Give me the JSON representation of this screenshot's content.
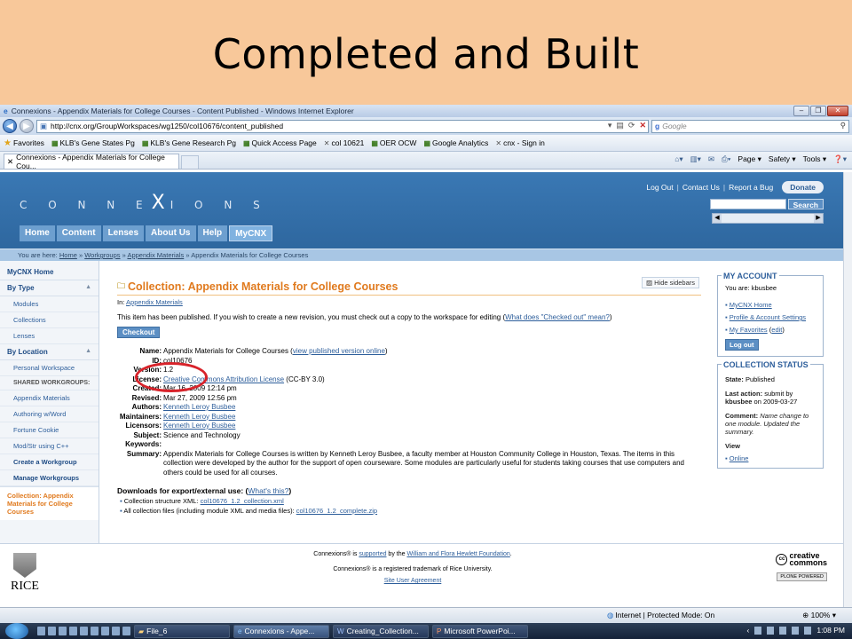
{
  "slide": {
    "title": "Completed and Built"
  },
  "browser": {
    "window_title": "Connexions - Appendix Materials for College Courses - Content Published - Windows Internet Explorer",
    "url": "http://cnx.org/GroupWorkspaces/wg1250/col10676/content_published",
    "search_placeholder": "Google",
    "favorites_label": "Favorites",
    "favorites": [
      "KLB's Gene States Pg",
      "KLB's Gene Research Pg",
      "Quick Access Page",
      "col 10621",
      "OER OCW",
      "Google Analytics",
      "cnx - Sign in"
    ],
    "tab_label": "Connexions - Appendix Materials for College Cou...",
    "commands": {
      "page": "Page",
      "safety": "Safety",
      "tools": "Tools"
    },
    "status_zone": "Internet | Protected Mode: On",
    "zoom": "100%"
  },
  "site": {
    "logo": {
      "left": "C O N N E",
      "mid": "X",
      "right": "I O N S"
    },
    "top_links": [
      "Log Out",
      "Contact Us",
      "Report a Bug"
    ],
    "donate": "Donate",
    "search_button": "Search",
    "nav_tabs": [
      "Home",
      "Content",
      "Lenses",
      "About Us",
      "Help",
      "MyCNX"
    ],
    "breadcrumb": {
      "prefix": "You are here:",
      "home": "Home",
      "workgroups": "Workgroups",
      "appendix": "Appendix Materials",
      "current": "Appendix Materials for College Courses"
    }
  },
  "sidebar": {
    "mycnx_home": "MyCNX Home",
    "by_type": "By Type",
    "type_items": [
      "Modules",
      "Collections",
      "Lenses"
    ],
    "by_location": "By Location",
    "personal_ws": "Personal Workspace",
    "shared_caption": "SHARED WORKGROUPS:",
    "workgroups": [
      "Appendix Materials",
      "Authoring w/Word",
      "Fortune Cookie",
      "Mod/Str using C++"
    ],
    "create_workgroup": "Create a Workgroup",
    "manage_workgroups": "Manage Workgroups",
    "current": "Collection: Appendix Materials for College Courses"
  },
  "main": {
    "title": "Collection: Appendix Materials for College Courses",
    "hide_sidebars": "Hide sidebars",
    "in_prefix": "In:",
    "in_link": "Appendix Materials",
    "published_msg": "This item has been published. If you wish to create a new revision, you must check out a copy to the workspace for editing (",
    "checked_out_link": "What does \"Checked out\" mean?",
    "published_msg_end": ")",
    "checkout": "Checkout",
    "meta": {
      "name_k": "Name:",
      "name_v": "Appendix Materials for College Courses (",
      "name_link": "view published version online",
      "name_end": ")",
      "id_k": "ID:",
      "id_v": "col10676",
      "version_k": "Version:",
      "version_v": "1.2",
      "license_k": "License:",
      "license_link": "Creative Commons Attribution License",
      "license_end": " (CC-BY 3.0)",
      "created_k": "Created:",
      "created_v": "Mar 16, 2009 12:14 pm",
      "revised_k": "Revised:",
      "revised_v": "Mar 27, 2009 12:56 pm",
      "authors_k": "Authors:",
      "authors_v": "Kenneth Leroy Busbee",
      "maintainers_k": "Maintainers:",
      "maintainers_v": "Kenneth Leroy Busbee",
      "licensors_k": "Licensors:",
      "licensors_v": "Kenneth Leroy Busbee",
      "subject_k": "Subject:",
      "subject_v": "Science and Technology",
      "keywords_k": "Keywords:",
      "summary_k": "Summary:",
      "summary_v": "Appendix Materials for College Courses is written by Kenneth Leroy Busbee, a faculty member at Houston Community College in Houston, Texas. The items in this collection were developed by the author for the support of open courseware. Some modules are particularly useful for students taking courses that use computers and others could be used for all courses."
    },
    "downloads_title": "Downloads for export/external use: (",
    "whats_this": "What's this?",
    "downloads_end": ")",
    "dl1_label": "Collection structure XML: ",
    "dl1_link": "col10676_1.2_collection.xml",
    "dl2_label": "All collection files (including module XML and media files): ",
    "dl2_link": "col10676_1.2_complete.zip"
  },
  "account": {
    "title": "MY ACCOUNT",
    "you_are": "You are: kbusbee",
    "links": [
      "MyCNX Home",
      "Profile & Account Settings"
    ],
    "favorites": "My Favorites",
    "edit": "edit",
    "logout": "Log out"
  },
  "status": {
    "title": "COLLECTION STATUS",
    "state_k": "State:",
    "state_v": "Published",
    "last_action_k": "Last action:",
    "last_action_v": "submit by",
    "last_action_user": "kbusbee",
    "last_action_date": "on 2009-03-27",
    "comment_k": "Comment:",
    "comment_v": "Name change to one module. Updated the summary.",
    "view_k": "View",
    "view_link": "Online"
  },
  "footer": {
    "rice": "RICE",
    "line1_a": "Connexions® is ",
    "line1_link1": "supported",
    "line1_b": " by the ",
    "line1_link2": "William and Flora Hewlett Foundation",
    "line1_c": ".",
    "line2": "Connexions® is a registered trademark of Rice University.",
    "line3": "Site User Agreement",
    "cc_top": "creative",
    "cc_bottom": "commons",
    "plone": "PLONE POWERED"
  },
  "taskbar": {
    "tasks": [
      "File_6",
      "Connexions - Appe...",
      "Creating_Collection...",
      "Microsoft PowerPoi..."
    ],
    "clock": "1:08 PM"
  }
}
